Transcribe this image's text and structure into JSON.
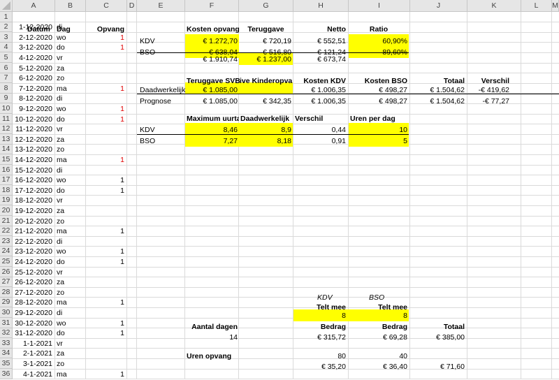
{
  "sheet": {
    "columns": [
      "A",
      "B",
      "C",
      "D",
      "E",
      "F",
      "G",
      "H",
      "I",
      "J",
      "K",
      "L",
      "M"
    ],
    "rows": 36
  },
  "cols_a_c": {
    "header": {
      "datum": "Datum",
      "dag": "Dag",
      "opvang": "Opvang"
    },
    "rows": [
      {
        "datum": "1-12-2020",
        "dag": "di",
        "opvang": ""
      },
      {
        "datum": "2-12-2020",
        "dag": "wo",
        "opvang": "1",
        "opvang_red": true
      },
      {
        "datum": "3-12-2020",
        "dag": "do",
        "opvang": "1",
        "opvang_red": true
      },
      {
        "datum": "4-12-2020",
        "dag": "vr",
        "opvang": ""
      },
      {
        "datum": "5-12-2020",
        "dag": "za",
        "opvang": ""
      },
      {
        "datum": "6-12-2020",
        "dag": "zo",
        "opvang": ""
      },
      {
        "datum": "7-12-2020",
        "dag": "ma",
        "opvang": "1",
        "opvang_red": true
      },
      {
        "datum": "8-12-2020",
        "dag": "di",
        "opvang": ""
      },
      {
        "datum": "9-12-2020",
        "dag": "wo",
        "opvang": "1",
        "opvang_red": true
      },
      {
        "datum": "10-12-2020",
        "dag": "do",
        "opvang": "1",
        "opvang_red": true
      },
      {
        "datum": "11-12-2020",
        "dag": "vr",
        "opvang": ""
      },
      {
        "datum": "12-12-2020",
        "dag": "za",
        "opvang": ""
      },
      {
        "datum": "13-12-2020",
        "dag": "zo",
        "opvang": ""
      },
      {
        "datum": "14-12-2020",
        "dag": "ma",
        "opvang": "1",
        "opvang_red": true
      },
      {
        "datum": "15-12-2020",
        "dag": "di",
        "opvang": ""
      },
      {
        "datum": "16-12-2020",
        "dag": "wo",
        "opvang": "1"
      },
      {
        "datum": "17-12-2020",
        "dag": "do",
        "opvang": "1"
      },
      {
        "datum": "18-12-2020",
        "dag": "vr",
        "opvang": ""
      },
      {
        "datum": "19-12-2020",
        "dag": "za",
        "opvang": ""
      },
      {
        "datum": "20-12-2020",
        "dag": "zo",
        "opvang": ""
      },
      {
        "datum": "21-12-2020",
        "dag": "ma",
        "opvang": "1"
      },
      {
        "datum": "22-12-2020",
        "dag": "di",
        "opvang": ""
      },
      {
        "datum": "23-12-2020",
        "dag": "wo",
        "opvang": "1"
      },
      {
        "datum": "24-12-2020",
        "dag": "do",
        "opvang": "1"
      },
      {
        "datum": "25-12-2020",
        "dag": "vr",
        "opvang": ""
      },
      {
        "datum": "26-12-2020",
        "dag": "za",
        "opvang": ""
      },
      {
        "datum": "27-12-2020",
        "dag": "zo",
        "opvang": ""
      },
      {
        "datum": "28-12-2020",
        "dag": "ma",
        "opvang": "1"
      },
      {
        "datum": "29-12-2020",
        "dag": "di",
        "opvang": ""
      },
      {
        "datum": "30-12-2020",
        "dag": "wo",
        "opvang": "1"
      },
      {
        "datum": "31-12-2020",
        "dag": "do",
        "opvang": "1"
      },
      {
        "datum": "1-1-2021",
        "dag": "vr",
        "opvang": ""
      },
      {
        "datum": "2-1-2021",
        "dag": "za",
        "opvang": ""
      },
      {
        "datum": "3-1-2021",
        "dag": "zo",
        "opvang": ""
      },
      {
        "datum": "4-1-2021",
        "dag": "ma",
        "opvang": "1"
      }
    ]
  },
  "costs_table": {
    "headers": {
      "kosten_opvang": "Kosten opvang",
      "teruggave": "Teruggave",
      "netto": "Netto",
      "ratio": "Ratio"
    },
    "kdv": {
      "label": "KDV",
      "kosten": "€ 1.272,70",
      "teruggave": "€ 720,19",
      "netto": "€ 552,51",
      "ratio": "60,90%"
    },
    "bso": {
      "label": "BSO",
      "kosten": "€ 638,04",
      "teruggave": "€ 516,80",
      "netto": "€ 121,24",
      "ratio": "89,60%"
    },
    "total": {
      "kosten": "€ 1.910,74",
      "teruggave": "€ 1.237,00",
      "netto": "€ 673,74"
    }
  },
  "svb_table": {
    "headers": {
      "teruggave_svb": "Teruggave SVB",
      "kinderopvang": "ive Kinderopvang",
      "kosten_kdv": "Kosten KDV",
      "kosten_bso": "Kosten BSO",
      "totaal": "Totaal",
      "verschil": "Verschil"
    },
    "daadwerkelijk": {
      "label": "Daadwerkelijk",
      "svb": "€ 1.085,00",
      "kinderopvang": "",
      "kosten_kdv": "€ 1.006,35",
      "kosten_bso": "€ 498,27",
      "totaal": "€ 1.504,62",
      "verschil": "-€ 419,62"
    },
    "prognose": {
      "label": "Prognose",
      "svb": "€ 1.085,00",
      "kinderopvang": "€ 342,35",
      "kosten_kdv": "€ 1.006,35",
      "kosten_bso": "€ 498,27",
      "totaal": "€ 1.504,62",
      "verschil": "-€ 77,27"
    }
  },
  "hours_table": {
    "headers": {
      "maximum": "Maximum uurtari",
      "daadwerkelijk": "Daadwerkelijk",
      "verschil": "Verschil",
      "uren_per_dag": "Uren per dag"
    },
    "kdv": {
      "label": "KDV",
      "maximum": "8,46",
      "daadwerkelijk": "8,9",
      "verschil": "0,44",
      "uren": "10"
    },
    "bso": {
      "label": "BSO",
      "maximum": "7,27",
      "daadwerkelijk": "8,18",
      "verschil": "0,91",
      "uren": "5"
    }
  },
  "summary": {
    "kdv_italic": "KDV",
    "bso_italic": "BSO",
    "telt_mee": "Telt mee",
    "telt_mee_kdv": "8",
    "telt_mee_bso": "8",
    "aantal_dagen_label": "Aantal dagen",
    "aantal_dagen": "14",
    "bedrag": "Bedrag",
    "totaal": "Totaal",
    "bedrag_kdv": "€ 315,72",
    "bedrag_bso": "€ 69,28",
    "bedrag_totaal": "€ 385,00",
    "uren_opvang_label": "Uren opvang",
    "uren_kdv": "80",
    "uren_bso": "40",
    "uren_bedrag_kdv": "€ 35,20",
    "uren_bedrag_bso": "€ 36,40",
    "uren_totaal": "€ 71,60"
  },
  "colors": {
    "highlight": "#ffff00",
    "red": "#e00000",
    "header_bg": "#e6e6e6"
  }
}
